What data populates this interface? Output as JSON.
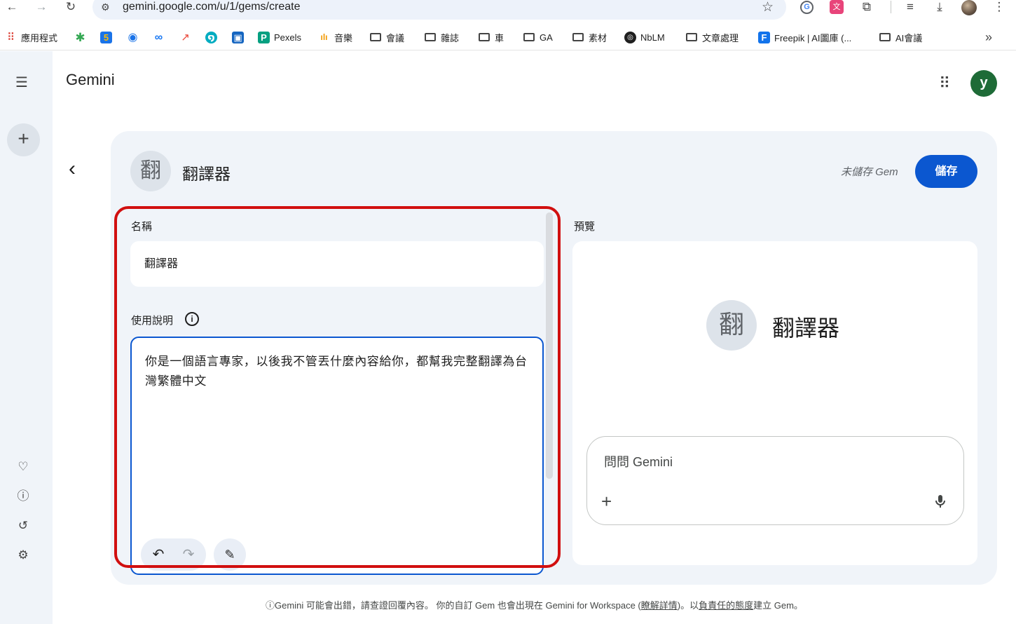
{
  "browser": {
    "url": "gemini.google.com/u/1/gems/create",
    "bookmarks": [
      {
        "label": "應用程式",
        "icon": "apps-grid-icon"
      },
      {
        "label": "",
        "icon": "clover-icon"
      },
      {
        "label": "",
        "icon": "calendar-5-icon"
      },
      {
        "label": "",
        "icon": "target-icon"
      },
      {
        "label": "",
        "icon": "meta-infinity-icon"
      },
      {
        "label": "",
        "icon": "trend-icon"
      },
      {
        "label": "",
        "icon": "spiral-icon"
      },
      {
        "label": "",
        "icon": "doc-icon"
      },
      {
        "label": "Pexels",
        "icon": "pexels-icon"
      },
      {
        "label": "音樂",
        "icon": "audio-bars-icon"
      },
      {
        "label": "會議",
        "icon": "folder-icon"
      },
      {
        "label": "雜誌",
        "icon": "folder-icon"
      },
      {
        "label": "車",
        "icon": "folder-icon"
      },
      {
        "label": "GA",
        "icon": "folder-icon"
      },
      {
        "label": "素材",
        "icon": "folder-icon"
      },
      {
        "label": "NbLM",
        "icon": "notebooklm-icon"
      },
      {
        "label": "文章處理",
        "icon": "folder-icon"
      },
      {
        "label": "Freepik | AI圖庫 (...",
        "icon": "freepik-icon"
      },
      {
        "label": "AI會議",
        "icon": "folder-icon"
      }
    ],
    "more_glyph": "»"
  },
  "app": {
    "title": "Gemini",
    "user_initial": "y"
  },
  "gem": {
    "avatar_char": "翻",
    "name": "翻譯器",
    "unsaved_label": "未儲存 Gem",
    "save_label": "儲存"
  },
  "form": {
    "name_label": "名稱",
    "name_value": "翻譯器",
    "instructions_label": "使用說明",
    "instructions_value": "你是一個語言專家，以後我不管丟什麼內容給你，都幫我完整翻譯為台灣繁體中文"
  },
  "preview": {
    "label": "預覽",
    "avatar_char": "翻",
    "name": "翻譯器",
    "ask_placeholder": "問問 Gemini"
  },
  "footer": {
    "prefix": "ⓘGemini 可能會出錯，請查證回覆內容。 你的自訂 Gem 也會出現在 Gemini for Workspace (",
    "learn_more": "瞭解詳情",
    "middle": ")。以",
    "responsible_link": "負責任的態度",
    "suffix": "建立 Gem。"
  },
  "colors": {
    "accent": "#0b57d0",
    "highlight": "#d10f0f",
    "panel_bg": "#f0f4f9",
    "avatar_green": "#1e6b37"
  }
}
